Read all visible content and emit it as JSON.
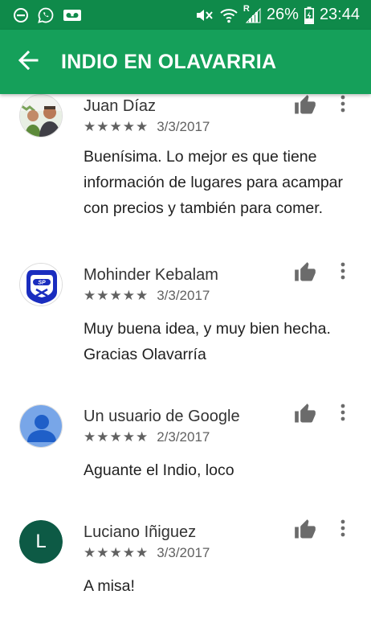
{
  "status_bar": {
    "icons_left": [
      "do-not-disturb-icon",
      "whatsapp-icon",
      "voicemail-icon"
    ],
    "icons_right": [
      "mute-icon",
      "wifi-icon",
      "signal-icon",
      "battery-charging-icon"
    ],
    "roaming": "R",
    "battery": "26%",
    "time": "23:44"
  },
  "app_bar": {
    "back_icon": "arrow-back-icon",
    "title": "INDIO EN OLAVARRIA"
  },
  "colors": {
    "status_bar": "#0f8a4a",
    "app_bar": "#15a05a",
    "icon_gray": "#616161"
  },
  "reviews": [
    {
      "name": "Juan Díaz",
      "stars": "★★★★★",
      "rating": 5,
      "date": "3/3/2017",
      "text": "Buenísima. Lo mejor es que tiene información de lugares para acampar con precios y también para comer.",
      "avatar": "photo-avatar"
    },
    {
      "name": "Mohinder Kebalam",
      "stars": "★★★★★",
      "rating": 5,
      "date": "3/3/2017",
      "text": "Muy buena idea, y muy bien hecha. Gracias Olavarría",
      "avatar": "sp-logo-avatar"
    },
    {
      "name": "Un usuario de Google",
      "stars": "★★★★★",
      "rating": 5,
      "date": "2/3/2017",
      "text": "Aguante el Indio, loco",
      "avatar": "default-user-avatar"
    },
    {
      "name": "Luciano Iñiguez",
      "stars": "★★★★★",
      "rating": 5,
      "date": "3/3/2017",
      "text": "A misa!",
      "avatar": "letter-avatar",
      "avatar_letter": "L",
      "avatar_color": "#0d5a45"
    }
  ]
}
